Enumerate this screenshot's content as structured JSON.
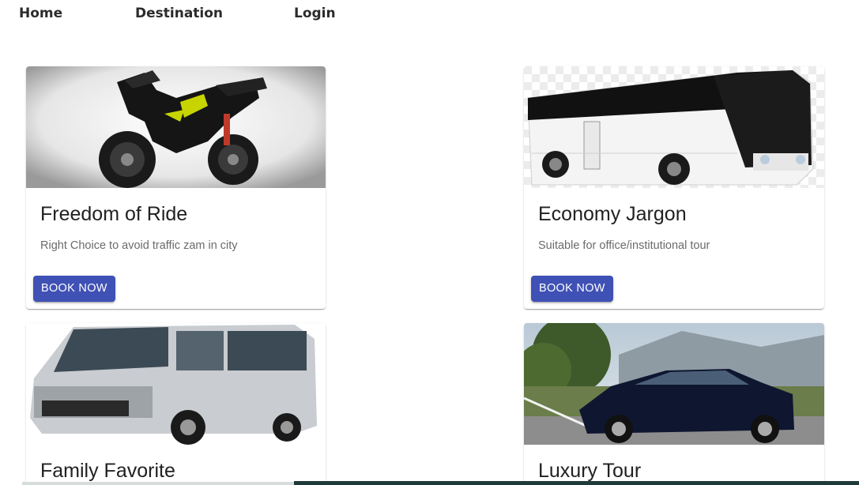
{
  "nav": {
    "home": "Home",
    "destination": "Destination",
    "login": "Login"
  },
  "cards": [
    {
      "title": "Freedom of Ride",
      "description": "Right Choice to avoid traffic zam in city",
      "button": "BOOK NOW",
      "image": "motorcycle"
    },
    {
      "title": "Economy Jargon",
      "description": "Suitable for office/institutional tour",
      "button": "BOOK NOW",
      "image": "bus"
    },
    {
      "title": "Family Favorite",
      "image": "van"
    },
    {
      "title": "Luxury Tour",
      "image": "sedan"
    }
  ],
  "colors": {
    "button": "#3f51b5",
    "nav_text": "#2b2b2b",
    "description": "#6b6b6b"
  }
}
